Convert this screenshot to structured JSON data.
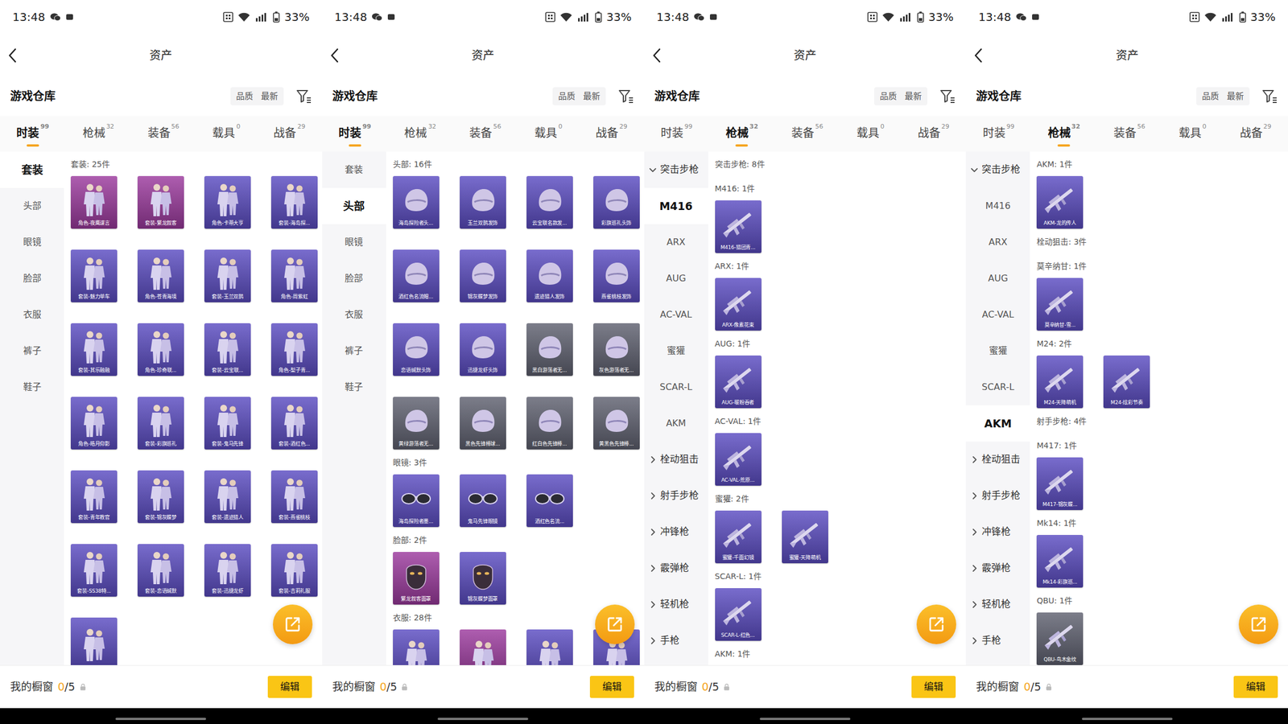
{
  "screens": [
    {
      "status_bar": {
        "time": "13:48",
        "battery": "33%"
      },
      "header": {
        "title": "资产"
      },
      "warehouse": {
        "title": "游戏仓库",
        "sorts": [
          "品质",
          "最新"
        ]
      },
      "tabs": [
        {
          "label": "时装",
          "count": "99",
          "selected": true
        },
        {
          "label": "枪械",
          "count": "32",
          "selected": false
        },
        {
          "label": "装备",
          "count": "56",
          "selected": false
        },
        {
          "label": "载具",
          "count": "0",
          "selected": false
        },
        {
          "label": "战备",
          "count": "29",
          "selected": false
        }
      ],
      "sidebar": [
        {
          "label": "套装",
          "kind": "item",
          "selected": true
        },
        {
          "label": "头部",
          "kind": "item",
          "selected": false
        },
        {
          "label": "眼镜",
          "kind": "item",
          "selected": false
        },
        {
          "label": "脸部",
          "kind": "item",
          "selected": false
        },
        {
          "label": "衣服",
          "kind": "item",
          "selected": false
        },
        {
          "label": "裤子",
          "kind": "item",
          "selected": false
        },
        {
          "label": "鞋子",
          "kind": "item",
          "selected": false
        }
      ],
      "sections": [
        {
          "title": "套装: 25件",
          "items": [
            {
              "label": "角色-夜鹰谍言",
              "kind": "outfit",
              "color": "#9c3a9e"
            },
            {
              "label": "套装-繁龙叙客",
              "kind": "outfit",
              "color": "#9c3a9e"
            },
            {
              "label": "角色-卡蒂大亨",
              "kind": "outfit",
              "color": "#5b4cc2"
            },
            {
              "label": "套装-海岛探...",
              "kind": "outfit",
              "color": "#5b4cc2"
            },
            {
              "label": "套装-魅力单车",
              "kind": "outfit",
              "color": "#5b4cc2"
            },
            {
              "label": "角色-苍青海境",
              "kind": "outfit",
              "color": "#5b4cc2"
            },
            {
              "label": "套装-玉兰双鹊",
              "kind": "outfit",
              "color": "#5b4cc2"
            },
            {
              "label": "角色-周紫虹",
              "kind": "outfit",
              "color": "#5b4cc2"
            },
            {
              "label": "套装-其乐融融",
              "kind": "outfit",
              "color": "#5b4cc2"
            },
            {
              "label": "角色-珍奇联...",
              "kind": "outfit",
              "color": "#5b4cc2"
            },
            {
              "label": "套装-云宝联...",
              "kind": "outfit",
              "color": "#5b4cc2"
            },
            {
              "label": "角色-梨子青...",
              "kind": "outfit",
              "color": "#5b4cc2"
            },
            {
              "label": "角色-皓月仰影",
              "kind": "outfit",
              "color": "#5b4cc2"
            },
            {
              "label": "套装-彩旗巡礼",
              "kind": "outfit",
              "color": "#5b4cc2"
            },
            {
              "label": "套装-鬼马先锋",
              "kind": "outfit",
              "color": "#5b4cc2"
            },
            {
              "label": "套装-酒红色...",
              "kind": "outfit",
              "color": "#5b4cc2"
            },
            {
              "label": "套装-青年教官",
              "kind": "outfit",
              "color": "#5b4cc2"
            },
            {
              "label": "套装-锦灰蝶梦",
              "kind": "outfit",
              "color": "#5b4cc2"
            },
            {
              "label": "套装-遗迹猎人",
              "kind": "outfit",
              "color": "#5b4cc2"
            },
            {
              "label": "套装-燕雀桃枝",
              "kind": "outfit",
              "color": "#5b4cc2"
            },
            {
              "label": "套装-SS38特...",
              "kind": "outfit",
              "color": "#5b4cc2"
            },
            {
              "label": "套装-恋语缄默",
              "kind": "outfit",
              "color": "#5b4cc2"
            },
            {
              "label": "套装-迅捷龙虾",
              "kind": "outfit",
              "color": "#5b4cc2"
            },
            {
              "label": "套装-吉莉礼服",
              "kind": "outfit",
              "color": "#5b4cc2"
            },
            {
              "kind": "outfit",
              "color": "#5b4cc2"
            }
          ]
        }
      ],
      "showcase": {
        "label": "我的橱窗",
        "used": "0",
        "total": "/5",
        "button": "编辑"
      }
    },
    {
      "status_bar": {
        "time": "13:48",
        "battery": "33%"
      },
      "header": {
        "title": "资产"
      },
      "warehouse": {
        "title": "游戏仓库",
        "sorts": [
          "品质",
          "最新"
        ]
      },
      "tabs": [
        {
          "label": "时装",
          "count": "99",
          "selected": true
        },
        {
          "label": "枪械",
          "count": "32",
          "selected": false
        },
        {
          "label": "装备",
          "count": "56",
          "selected": false
        },
        {
          "label": "载具",
          "count": "0",
          "selected": false
        },
        {
          "label": "战备",
          "count": "29",
          "selected": false
        }
      ],
      "sidebar": [
        {
          "label": "套装",
          "kind": "item",
          "selected": false
        },
        {
          "label": "头部",
          "kind": "item",
          "selected": true
        },
        {
          "label": "眼镜",
          "kind": "item",
          "selected": false
        },
        {
          "label": "脸部",
          "kind": "item",
          "selected": false
        },
        {
          "label": "衣服",
          "kind": "item",
          "selected": false
        },
        {
          "label": "裤子",
          "kind": "item",
          "selected": false
        },
        {
          "label": "鞋子",
          "kind": "item",
          "selected": false
        }
      ],
      "sections": [
        {
          "title": "头部: 16件",
          "items": [
            {
              "label": "海岛探险者头...",
              "kind": "head",
              "color": "#5b4cc2"
            },
            {
              "label": "玉兰双鹊发饰",
              "kind": "head",
              "color": "#5b4cc2"
            },
            {
              "label": "云宝联名款发...",
              "kind": "head",
              "color": "#5b4cc2"
            },
            {
              "label": "彩旗巡礼头饰",
              "kind": "head",
              "color": "#5b4cc2"
            },
            {
              "label": "酒红色名流帽...",
              "kind": "head",
              "color": "#5b4cc2"
            },
            {
              "label": "锦灰蝶梦发饰",
              "kind": "head",
              "color": "#5b4cc2"
            },
            {
              "label": "遗迹猎人发饰",
              "kind": "head",
              "color": "#5b4cc2"
            },
            {
              "label": "燕雀桃枝发饰",
              "kind": "head",
              "color": "#5b4cc2"
            },
            {
              "label": "恋语缄默头饰",
              "kind": "head",
              "color": "#5b4cc2"
            },
            {
              "label": "迅捷龙虾头饰",
              "kind": "head",
              "color": "#5b4cc2"
            },
            {
              "label": "黑白游荡者无...",
              "kind": "head",
              "color": "#5f6170"
            },
            {
              "label": "灰色游荡者无...",
              "kind": "head",
              "color": "#5f6170"
            },
            {
              "label": "黄绿游荡者无...",
              "kind": "head",
              "color": "#5f6170"
            },
            {
              "label": "黑色先锋棒球...",
              "kind": "head",
              "color": "#5f6170"
            },
            {
              "label": "红白色先锋棒...",
              "kind": "head",
              "color": "#5f6170"
            },
            {
              "label": "黄黑色先锋棒...",
              "kind": "head",
              "color": "#5f6170"
            }
          ]
        },
        {
          "title": "眼镜: 3件",
          "items": [
            {
              "label": "海岛探险者墨...",
              "kind": "glasses",
              "color": "#5b4cc2"
            },
            {
              "label": "鬼马先锋眼镜",
              "kind": "glasses",
              "color": "#5b4cc2"
            },
            {
              "label": "酒红色名流...",
              "kind": "glasses",
              "color": "#5b4cc2"
            }
          ]
        },
        {
          "title": "脸部: 2件",
          "items": [
            {
              "label": "繁龙叙客面罩",
              "kind": "face",
              "color": "#9c3a9e"
            },
            {
              "label": "锦灰蝶梦面罩",
              "kind": "face",
              "color": "#5b4cc2"
            }
          ]
        },
        {
          "title": "衣服: 28件",
          "items": [
            {
              "kind": "outfit",
              "color": "#5b4cc2"
            },
            {
              "kind": "outfit",
              "color": "#9c3a9e"
            },
            {
              "kind": "outfit",
              "color": "#5b4cc2"
            },
            {
              "kind": "outfit",
              "color": "#5b4cc2"
            }
          ]
        }
      ],
      "showcase": {
        "label": "我的橱窗",
        "used": "0",
        "total": "/5",
        "button": "编辑"
      }
    },
    {
      "status_bar": {
        "time": "13:48",
        "battery": "33%"
      },
      "header": {
        "title": "资产"
      },
      "warehouse": {
        "title": "游戏仓库",
        "sorts": [
          "品质",
          "最新"
        ]
      },
      "tabs": [
        {
          "label": "时装",
          "count": "99",
          "selected": false
        },
        {
          "label": "枪械",
          "count": "32",
          "selected": true
        },
        {
          "label": "装备",
          "count": "56",
          "selected": false
        },
        {
          "label": "载具",
          "count": "0",
          "selected": false
        },
        {
          "label": "战备",
          "count": "29",
          "selected": false
        }
      ],
      "sidebar": [
        {
          "label": "突击步枪",
          "kind": "group",
          "expanded": true,
          "selected": false
        },
        {
          "label": "M416",
          "kind": "item",
          "selected": true
        },
        {
          "label": "ARX",
          "kind": "item",
          "selected": false
        },
        {
          "label": "AUG",
          "kind": "item",
          "selected": false
        },
        {
          "label": "AC-VAL",
          "kind": "item",
          "selected": false
        },
        {
          "label": "蜜獾",
          "kind": "item",
          "selected": false
        },
        {
          "label": "SCAR-L",
          "kind": "item",
          "selected": false
        },
        {
          "label": "AKM",
          "kind": "item",
          "selected": false
        },
        {
          "label": "栓动狙击",
          "kind": "group",
          "expanded": false,
          "selected": false
        },
        {
          "label": "射手步枪",
          "kind": "group",
          "expanded": false,
          "selected": false
        },
        {
          "label": "冲锋枪",
          "kind": "group",
          "expanded": false,
          "selected": false
        },
        {
          "label": "霰弹枪",
          "kind": "group",
          "expanded": false,
          "selected": false
        },
        {
          "label": "轻机枪",
          "kind": "group",
          "expanded": false,
          "selected": false
        },
        {
          "label": "手枪",
          "kind": "group",
          "expanded": false,
          "selected": false
        }
      ],
      "sections": [
        {
          "title": "突击步枪: 8件",
          "items": []
        },
        {
          "title": "M416: 1件",
          "items": [
            {
              "label": "M416-猎团青...",
              "kind": "gun",
              "color": "#5b4cc2"
            }
          ]
        },
        {
          "title": "ARX: 1件",
          "items": [
            {
              "label": "ARX-像素花束",
              "kind": "gun",
              "color": "#5b4cc2"
            }
          ]
        },
        {
          "title": "AUG: 1件",
          "items": [
            {
              "label": "AUG-暖粉吞者",
              "kind": "gun",
              "color": "#5b4cc2"
            }
          ]
        },
        {
          "title": "AC-VAL: 1件",
          "items": [
            {
              "label": "AC-VAL-荒原...",
              "kind": "gun",
              "color": "#5b4cc2"
            }
          ]
        },
        {
          "title": "蜜獾: 2件",
          "items": [
            {
              "label": "蜜獾-千面幻镜",
              "kind": "gun",
              "color": "#5b4cc2"
            },
            {
              "label": "蜜獾-天降萌机",
              "kind": "gun",
              "color": "#5b4cc2"
            }
          ]
        },
        {
          "title": "SCAR-L: 1件",
          "items": [
            {
              "label": "SCAR-L-红色...",
              "kind": "gun",
              "color": "#5b4cc2"
            }
          ]
        },
        {
          "title": "AKM: 1件",
          "items": []
        }
      ],
      "showcase": {
        "label": "我的橱窗",
        "used": "0",
        "total": "/5",
        "button": "编辑"
      }
    },
    {
      "status_bar": {
        "time": "13:48",
        "battery": "33%"
      },
      "header": {
        "title": "资产"
      },
      "warehouse": {
        "title": "游戏仓库",
        "sorts": [
          "品质",
          "最新"
        ]
      },
      "tabs": [
        {
          "label": "时装",
          "count": "99",
          "selected": false
        },
        {
          "label": "枪械",
          "count": "32",
          "selected": true
        },
        {
          "label": "装备",
          "count": "56",
          "selected": false
        },
        {
          "label": "载具",
          "count": "0",
          "selected": false
        },
        {
          "label": "战备",
          "count": "29",
          "selected": false
        }
      ],
      "sidebar": [
        {
          "label": "突击步枪",
          "kind": "group",
          "expanded": true,
          "selected": false
        },
        {
          "label": "M416",
          "kind": "item",
          "selected": false
        },
        {
          "label": "ARX",
          "kind": "item",
          "selected": false
        },
        {
          "label": "AUG",
          "kind": "item",
          "selected": false
        },
        {
          "label": "AC-VAL",
          "kind": "item",
          "selected": false
        },
        {
          "label": "蜜獾",
          "kind": "item",
          "selected": false
        },
        {
          "label": "SCAR-L",
          "kind": "item",
          "selected": false
        },
        {
          "label": "AKM",
          "kind": "item",
          "selected": true
        },
        {
          "label": "栓动狙击",
          "kind": "group",
          "expanded": false,
          "selected": false
        },
        {
          "label": "射手步枪",
          "kind": "group",
          "expanded": false,
          "selected": false
        },
        {
          "label": "冲锋枪",
          "kind": "group",
          "expanded": false,
          "selected": false
        },
        {
          "label": "霰弹枪",
          "kind": "group",
          "expanded": false,
          "selected": false
        },
        {
          "label": "轻机枪",
          "kind": "group",
          "expanded": false,
          "selected": false
        },
        {
          "label": "手枪",
          "kind": "group",
          "expanded": false,
          "selected": false
        }
      ],
      "sections": [
        {
          "title": "AKM: 1件",
          "items": [
            {
              "label": "AKM-龙的传人",
              "kind": "gun",
              "color": "#5b4cc2"
            }
          ]
        },
        {
          "title": "栓动狙击: 3件",
          "items": []
        },
        {
          "title": "莫辛纳甘: 1件",
          "items": [
            {
              "label": "莫辛纳甘-雪...",
              "kind": "gun",
              "color": "#5b4cc2"
            }
          ]
        },
        {
          "title": "M24: 2件",
          "items": [
            {
              "label": "M24-天降萌机",
              "kind": "gun",
              "color": "#5b4cc2"
            },
            {
              "label": "M24-炫彩节奏",
              "kind": "gun",
              "color": "#5b4cc2"
            }
          ]
        },
        {
          "title": "射手步枪: 4件",
          "items": []
        },
        {
          "title": "M417: 1件",
          "items": [
            {
              "label": "M417-锦灰蝶...",
              "kind": "gun",
              "color": "#5b4cc2"
            }
          ]
        },
        {
          "title": "Mk14: 1件",
          "items": [
            {
              "label": "Mk14-彩旗巡...",
              "kind": "gun",
              "color": "#5b4cc2"
            }
          ]
        },
        {
          "title": "QBU: 1件",
          "items": [
            {
              "label": "QBU-鸟木金纹",
              "kind": "gun",
              "color": "#5f6170"
            }
          ]
        }
      ],
      "showcase": {
        "label": "我的橱窗",
        "used": "0",
        "total": "/5",
        "button": "编辑"
      }
    }
  ]
}
